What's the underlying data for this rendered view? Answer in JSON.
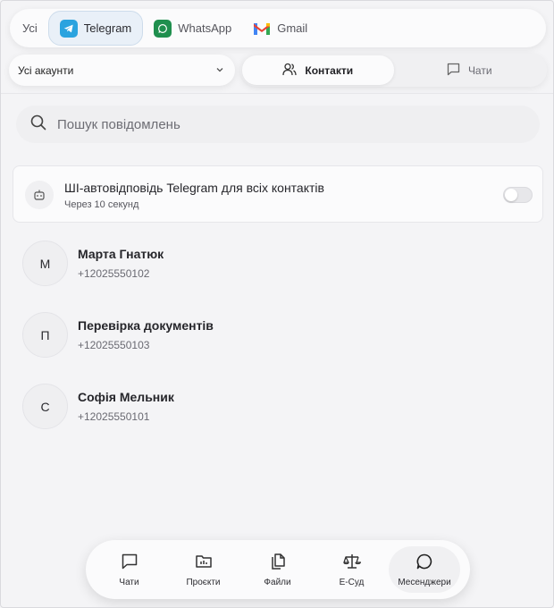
{
  "platform_tabs": [
    {
      "label": "Усі",
      "icon": "none"
    },
    {
      "label": "Telegram",
      "icon": "telegram-icon",
      "active": true
    },
    {
      "label": "WhatsApp",
      "icon": "whatsapp-icon"
    },
    {
      "label": "Gmail",
      "icon": "gmail-icon"
    }
  ],
  "account_select": {
    "value": "Усі акаунти",
    "icon": "chevron-down-icon"
  },
  "segments": [
    {
      "label": "Контакти",
      "icon": "users-icon",
      "active": true
    },
    {
      "label": "Чати",
      "icon": "chat-icon"
    }
  ],
  "search": {
    "placeholder": "Пошук повідомлень",
    "value": "",
    "icon": "search-icon"
  },
  "auto_reply": {
    "title": "ШІ-автовідповідь Telegram для всіх контактів",
    "subtitle": "Через 10 секунд",
    "enabled": false,
    "icon": "bot-icon"
  },
  "contacts": [
    {
      "initial": "М",
      "name": "Марта Гнатюк",
      "phone": "+12025550102"
    },
    {
      "initial": "П",
      "name": "Перевірка документів",
      "phone": "+12025550103"
    },
    {
      "initial": "С",
      "name": "Софія Мельник",
      "phone": "+12025550101"
    }
  ],
  "bottom_nav": [
    {
      "label": "Чати",
      "icon": "chat-icon"
    },
    {
      "label": "Проєкти",
      "icon": "folder-chart-icon"
    },
    {
      "label": "Файли",
      "icon": "files-icon"
    },
    {
      "label": "Е-Суд",
      "icon": "scales-icon"
    },
    {
      "label": "Месенджери",
      "icon": "message-circle-icon",
      "active": true
    }
  ],
  "colors": {
    "telegram": "#2aa3df",
    "whatsapp": "#1f8f4e",
    "active_tab_bg": "#e9f0f8"
  }
}
